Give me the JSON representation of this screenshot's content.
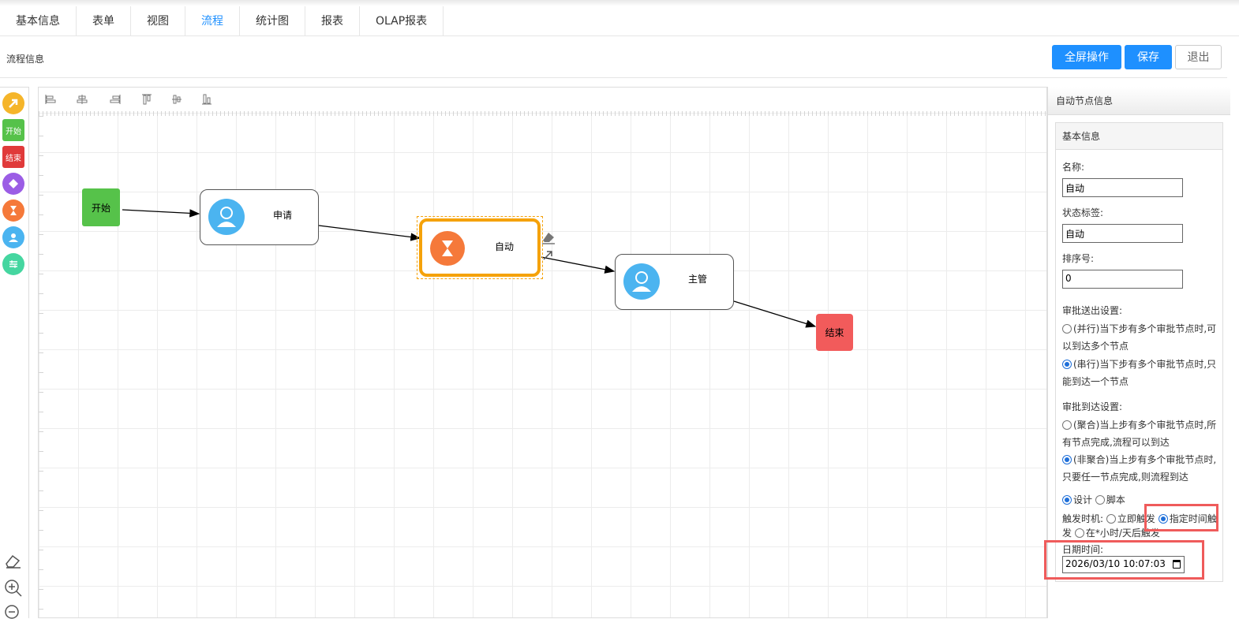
{
  "tabs": [
    "基本信息",
    "表单",
    "视图",
    "流程",
    "统计图",
    "报表",
    "OLAP报表"
  ],
  "active_tab": "流程",
  "header": {
    "title": "流程信息",
    "fullscreen_label": "全屏操作",
    "save_label": "保存",
    "exit_label": "退出"
  },
  "palette": {
    "start_label": "开始",
    "end_label": "结束"
  },
  "diagram": {
    "start": "开始",
    "apply": "申请",
    "auto": "自动",
    "manager": "主管",
    "end": "结束"
  },
  "panel": {
    "title": "自动节点信息",
    "section": "基本信息",
    "name_label": "名称:",
    "name_value": "自动",
    "status_label": "状态标签:",
    "status_value": "自动",
    "order_label": "排序号:",
    "order_value": "0",
    "send_title": "审批送出设置:",
    "send_opt1": "(并行)当下步有多个审批节点时,可以到达多个节点",
    "send_opt2": "(串行)当下步有多个审批节点时,只能到达一个节点",
    "arrive_title": "审批到达设置:",
    "arrive_opt1": "(聚合)当上步有多个审批节点时,所有节点完成,流程可以到达",
    "arrive_opt2": "(非聚合)当上步有多个审批节点时,只要任一节点完成,则流程到达",
    "mode_design": "设计",
    "mode_script": "脚本",
    "trigger_label": "触发时机:",
    "trigger_now": "立即触发",
    "trigger_time": "指定时间触发",
    "trigger_after": "在*小时/天后触发",
    "datetime_label": "日期时间:",
    "datetime_value": "2026/03/10 10:07:03"
  },
  "colors": {
    "primary": "#1e90ff",
    "start": "#56c24a",
    "end": "#f25b5b",
    "auto_border": "#f5a20a",
    "auto_icon": "#f5793a",
    "user_icon": "#4bb4f0",
    "highlight": "#ef5b5b"
  }
}
